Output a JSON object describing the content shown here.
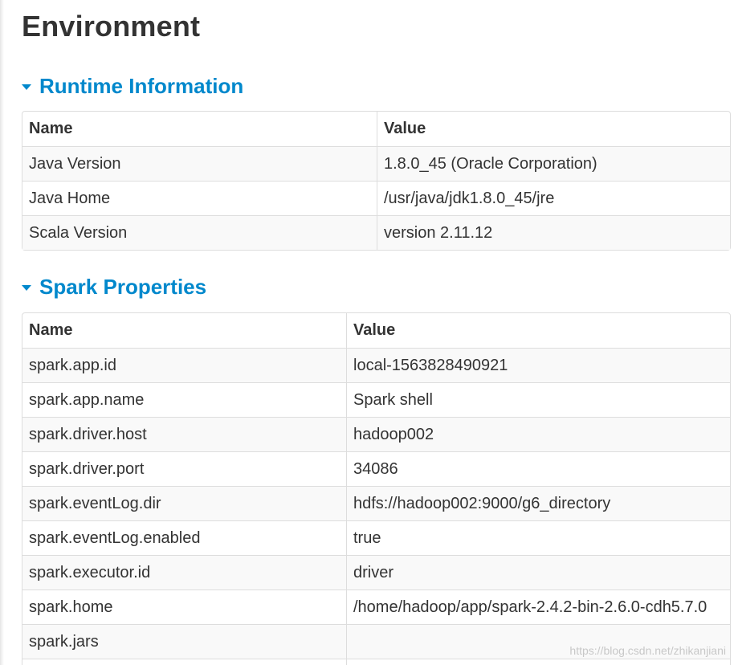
{
  "page": {
    "title": "Environment"
  },
  "runtime": {
    "header": "Runtime Information",
    "columns": [
      "Name",
      "Value"
    ],
    "rows": [
      [
        "Java Version",
        "1.8.0_45 (Oracle Corporation)"
      ],
      [
        "Java Home",
        "/usr/java/jdk1.8.0_45/jre"
      ],
      [
        "Scala Version",
        "version 2.11.12"
      ]
    ]
  },
  "spark": {
    "header": "Spark Properties",
    "columns": [
      "Name",
      "Value"
    ],
    "rows": [
      [
        "spark.app.id",
        "local-1563828490921"
      ],
      [
        "spark.app.name",
        "Spark shell"
      ],
      [
        "spark.driver.host",
        "hadoop002"
      ],
      [
        "spark.driver.port",
        "34086"
      ],
      [
        "spark.eventLog.dir",
        "hdfs://hadoop002:9000/g6_directory"
      ],
      [
        "spark.eventLog.enabled",
        "true"
      ],
      [
        "spark.executor.id",
        "driver"
      ],
      [
        "spark.home",
        "/home/hadoop/app/spark-2.4.2-bin-2.6.0-cdh5.7.0"
      ],
      [
        "spark.jars",
        ""
      ],
      [
        "",
        ""
      ]
    ]
  },
  "watermark": "https://blog.csdn.net/zhikanjiani",
  "colors": {
    "accent": "#0088cc",
    "text": "#333333",
    "border": "#dddddd",
    "stripe": "#f9f9f9"
  }
}
